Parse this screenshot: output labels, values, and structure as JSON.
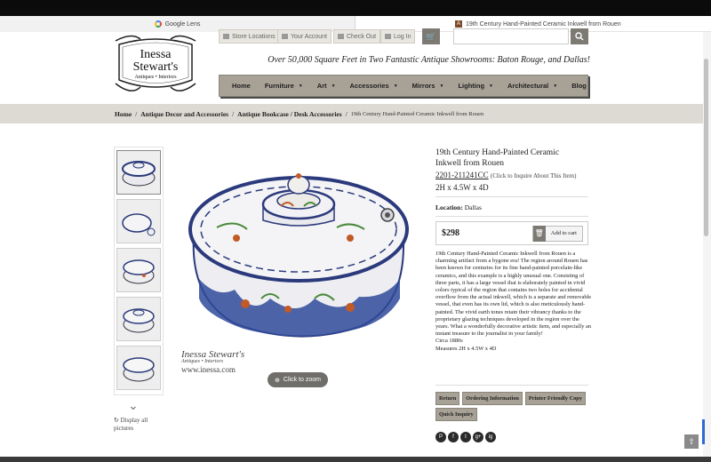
{
  "browser": {
    "tab1_title": "Google Lens",
    "tab2_title": "19th Century Hand-Painted Ceramic Inkwell from Rouen",
    "tab2_favicon": "A"
  },
  "header": {
    "logo": {
      "line1": "Inessa",
      "line2": "Stewart's",
      "line3": "Antiques • Interiors"
    },
    "util_links": [
      "Store Locations",
      "Your Account",
      "Check Out",
      "Log In"
    ],
    "search": {
      "value": "",
      "placeholder": ""
    },
    "tagline": "Over 50,000 Square Feet in Two Fantastic Antique Showrooms: Baton Rouge, and Dallas!"
  },
  "nav": {
    "items": [
      {
        "label": "Home",
        "caret": false
      },
      {
        "label": "Furniture",
        "caret": true
      },
      {
        "label": "Art",
        "caret": true
      },
      {
        "label": "Accessories",
        "caret": true
      },
      {
        "label": "Mirrors",
        "caret": true
      },
      {
        "label": "Lighting",
        "caret": true
      },
      {
        "label": "Architectural",
        "caret": true
      },
      {
        "label": "Blog",
        "caret": false
      }
    ]
  },
  "breadcrumb": {
    "items": [
      "Home",
      "Antique Decor and Accessories",
      "Antique Bookcase / Desk Accessories"
    ],
    "current": "19th Century Hand-Painted Ceramic Inkwell from Rouen"
  },
  "gallery": {
    "display_all": "Display all pictures",
    "zoom_label": "Click to zoom",
    "watermark": {
      "name": "Inessa Stewart's",
      "sub": "Antiques • Interiors",
      "url": "www.inessa.com"
    }
  },
  "product": {
    "title": "19th Century Hand-Painted Ceramic Inkwell from Rouen",
    "sku": "2201-211241CC",
    "sku_note": "(Click to Inquire About This Item)",
    "dims": "2H x 4.5W x 4D",
    "location_label": "Location:",
    "location_value": "Dallas",
    "price": "$298",
    "add_to_cart": "Add to cart",
    "description": "19th Century Hand-Painted Ceramic Inkwell from Rouen is a charming artifact from a bygone era!  The region around Rouen has been known for centuries for its fine hand-painted porcelain-like ceramics, and this example is a highly unusual one.  Consisting of three parts, it has a large vessel that is elaborately painted in vivid colors typical of the region that contains two holes for accidental overflow from the actual inkwell, which is a separate and removable vessel, that even has its own lid, which is also meticulously hand-painted.  The vivid earth tones retain their vibrancy thanks to the proprietary glazing techniques developed in the region over the years.  What a wonderfully decorative artistic item, and especially an instant treasure to the journalist in your family!",
    "circa": "Circa 1880s",
    "measures": "Measures 2H x 4.5W x 4D",
    "buttons": [
      "Return",
      "Ordering Information",
      "Printer Friendly Copy",
      "Quick Inquiry"
    ],
    "social": [
      "P",
      "f",
      "t",
      "g+",
      "ig"
    ]
  },
  "colors": {
    "nav_bg": "#a8a296",
    "crumb_bg": "#dcdad2",
    "button_bg": "#a8a296"
  }
}
